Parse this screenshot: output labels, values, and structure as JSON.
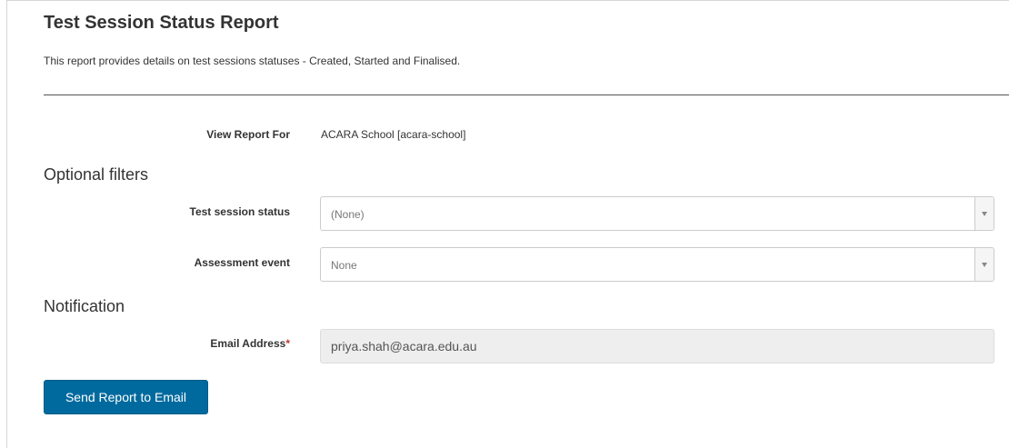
{
  "report": {
    "title": "Test Session Status Report",
    "description": "This report provides details on test sessions statuses - Created, Started and Finalised."
  },
  "view_report_for": {
    "label": "View Report For",
    "value": "ACARA School [acara-school]"
  },
  "optional_filters": {
    "heading": "Optional filters",
    "test_session_status": {
      "label": "Test session status",
      "selected": "(None)"
    },
    "assessment_event": {
      "label": "Assessment event",
      "selected": "None"
    }
  },
  "notification": {
    "heading": "Notification",
    "email": {
      "label": "Email Address",
      "required_marker": "*",
      "value": "priya.shah@acara.edu.au"
    }
  },
  "actions": {
    "send_label": "Send Report to Email"
  },
  "colors": {
    "primary_button": "#006a9e",
    "required_marker": "#c0392b"
  },
  "icons": {
    "dropdown": "caret-down-icon"
  }
}
